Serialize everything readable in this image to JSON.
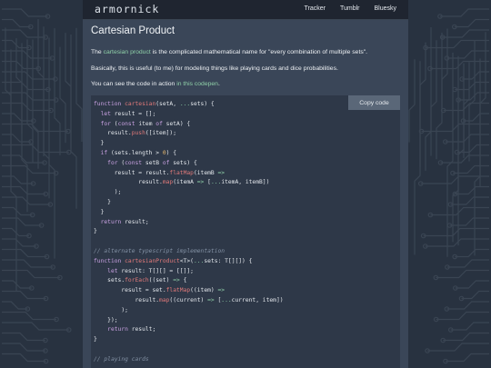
{
  "header": {
    "brand": "armornick",
    "nav": [
      "Tracker",
      "Tumblr",
      "Bluesky"
    ]
  },
  "article": {
    "title": "Cartesian Product",
    "p1_before": "The ",
    "p1_link": "cartesian product",
    "p1_after": " is the complicated mathematical name for \"every combination of multiple sets\".",
    "p2": "Basically, this is useful (to me) for modeling things like playing cards and dice probabilities.",
    "p3_before": "You can see the code in action ",
    "p3_link": "in this codepen",
    "p3_after": "."
  },
  "code": {
    "copy_label": "Copy code",
    "lines": [
      "function cartesian(setA, ...sets) {",
      "  let result = [];",
      "  for (const item of setA) {",
      "    result.push([item]);",
      "  }",
      "  if (sets.length > 0) {",
      "    for (const setB of sets) {",
      "      result = result.flatMap(itemB =>",
      "             result.map(itemA => [...itemA, itemB])",
      "      );",
      "    }",
      "  }",
      "  return result;",
      "}",
      "",
      "// alternate typescript implementation",
      "function cartesianProduct<T>(...sets: T[][]) {",
      "    let result: T[][] = [[]];",
      "    sets.forEach((set) => {",
      "        result = set.flatMap((item) =>",
      "            result.map((current) => [...current, item])",
      "        );",
      "    });",
      "    return result;",
      "}",
      "",
      "// playing cards"
    ]
  },
  "colors": {
    "background": "#283240",
    "panel": "#3a4658",
    "code_bg": "#2e3848",
    "link": "#8fd0a8"
  }
}
